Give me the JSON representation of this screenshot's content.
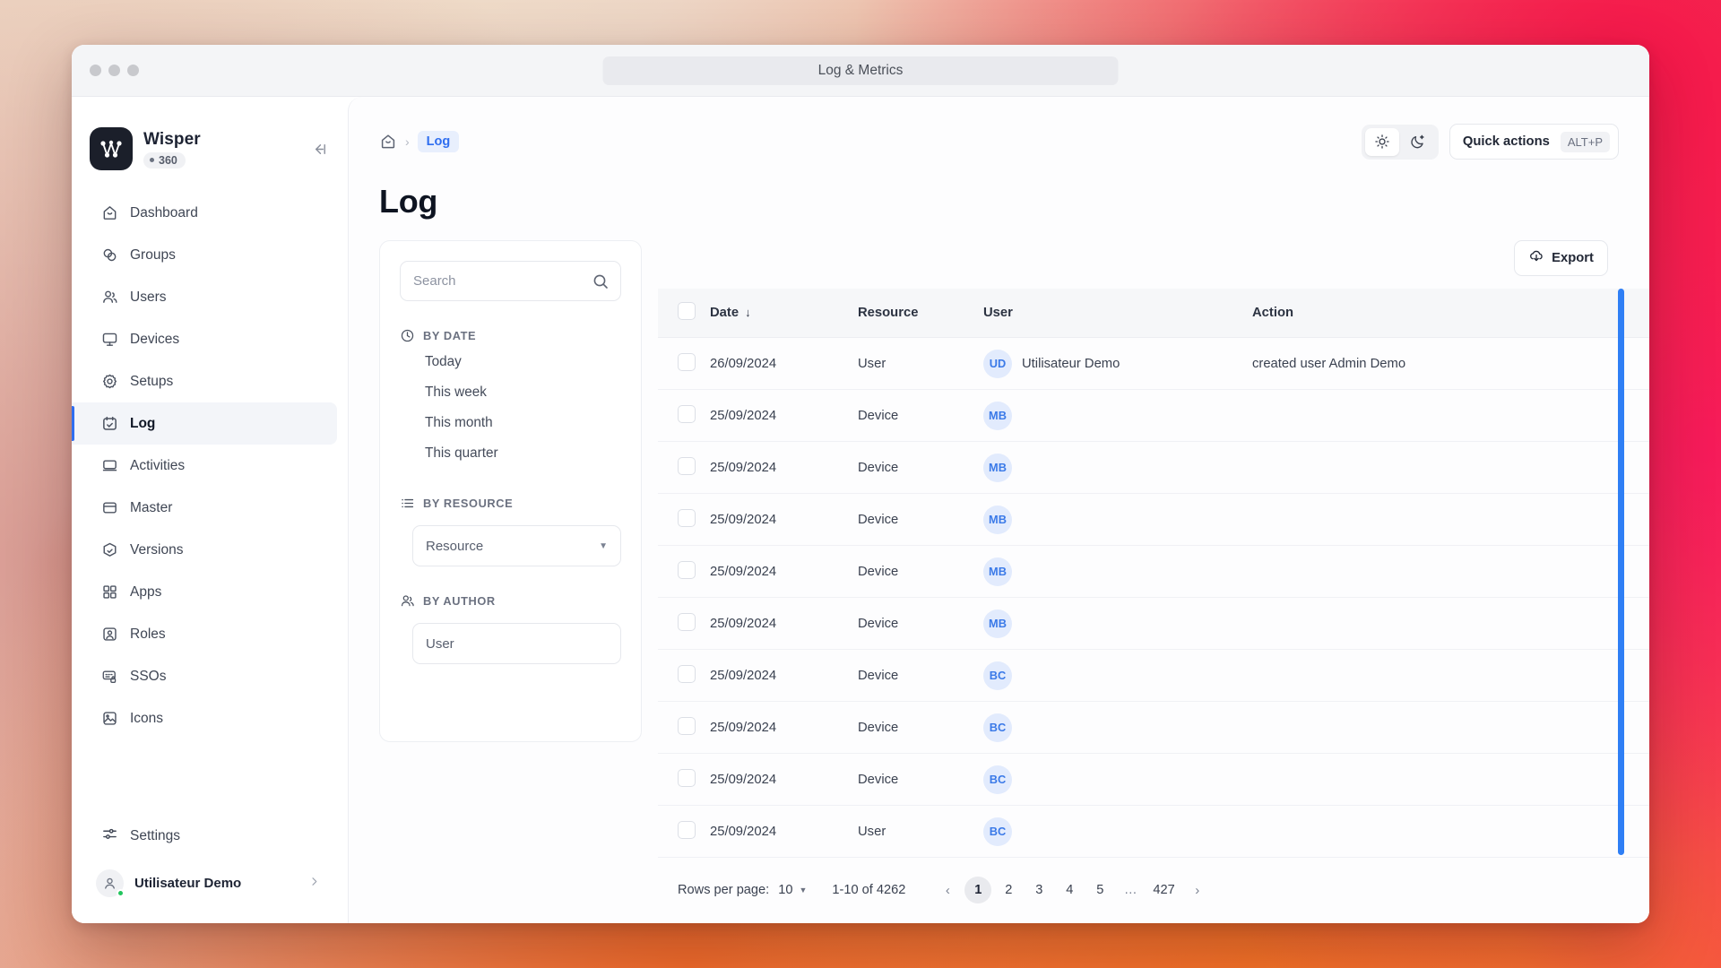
{
  "window": {
    "title": "Log & Metrics",
    "traffic_lights": [
      "close",
      "minimize",
      "maximize"
    ]
  },
  "sidebar": {
    "brand": {
      "name": "Wisper",
      "badge": "360",
      "logo_icon": "wisper-logo-icon"
    },
    "collapse_icon": "collapse-sidebar-icon",
    "items": [
      {
        "label": "Dashboard",
        "icon": "home-icon",
        "active": false
      },
      {
        "label": "Groups",
        "icon": "groups-icon",
        "active": false
      },
      {
        "label": "Users",
        "icon": "users-icon",
        "active": false
      },
      {
        "label": "Devices",
        "icon": "monitor-icon",
        "active": false
      },
      {
        "label": "Setups",
        "icon": "gear-icon",
        "active": false
      },
      {
        "label": "Log",
        "icon": "calendar-check-icon",
        "active": true
      },
      {
        "label": "Activities",
        "icon": "laptop-icon",
        "active": false
      },
      {
        "label": "Master",
        "icon": "window-icon",
        "active": false
      },
      {
        "label": "Versions",
        "icon": "box-check-icon",
        "active": false
      },
      {
        "label": "Apps",
        "icon": "grid-icon",
        "active": false
      },
      {
        "label": "Roles",
        "icon": "user-square-icon",
        "active": false
      },
      {
        "label": "SSOs",
        "icon": "sso-lock-icon",
        "active": false
      },
      {
        "label": "Icons",
        "icon": "image-icon",
        "active": false
      }
    ],
    "settings": {
      "label": "Settings",
      "icon": "sliders-icon"
    },
    "profile": {
      "name": "Utilisateur Demo",
      "avatar_icon": "user-avatar-icon",
      "status": "online",
      "chevron_icon": "chevron-right-icon"
    }
  },
  "topbar": {
    "breadcrumb": {
      "home_icon": "home-icon",
      "separator": "›",
      "current": "Log"
    },
    "theme": {
      "light_icon": "sun-icon",
      "dark_icon": "moon-icon",
      "selected": "light"
    },
    "quick_actions": {
      "label": "Quick actions",
      "shortcut": "ALT+P"
    }
  },
  "page": {
    "title": "Log"
  },
  "filters": {
    "search": {
      "placeholder": "Search",
      "value": "",
      "icon": "search-icon"
    },
    "by_date": {
      "label": "BY DATE",
      "icon": "clock-icon",
      "options": [
        "Today",
        "This week",
        "This month",
        "This quarter"
      ]
    },
    "by_resource": {
      "label": "BY RESOURCE",
      "icon": "list-icon",
      "select_placeholder": "Resource",
      "caret_icon": "chevron-down-icon"
    },
    "by_author": {
      "label": "BY AUTHOR",
      "icon": "users-icon",
      "input_placeholder": "User",
      "value": ""
    }
  },
  "toolbar": {
    "export_label": "Export",
    "export_icon": "cloud-download-icon"
  },
  "table": {
    "columns": [
      "Date",
      "Resource",
      "User",
      "Action"
    ],
    "sort": {
      "column": "Date",
      "direction": "desc",
      "icon": "arrow-down-icon"
    },
    "select_all_checkbox": false,
    "rows": [
      {
        "date": "26/09/2024",
        "resource": "User",
        "initials": "UD",
        "user": "Utilisateur Demo",
        "action": "created user Admin Demo"
      },
      {
        "date": "25/09/2024",
        "resource": "Device",
        "initials": "MB",
        "user": "",
        "action": ""
      },
      {
        "date": "25/09/2024",
        "resource": "Device",
        "initials": "MB",
        "user": "",
        "action": ""
      },
      {
        "date": "25/09/2024",
        "resource": "Device",
        "initials": "MB",
        "user": "",
        "action": ""
      },
      {
        "date": "25/09/2024",
        "resource": "Device",
        "initials": "MB",
        "user": "",
        "action": ""
      },
      {
        "date": "25/09/2024",
        "resource": "Device",
        "initials": "MB",
        "user": "",
        "action": ""
      },
      {
        "date": "25/09/2024",
        "resource": "Device",
        "initials": "BC",
        "user": "",
        "action": ""
      },
      {
        "date": "25/09/2024",
        "resource": "Device",
        "initials": "BC",
        "user": "",
        "action": ""
      },
      {
        "date": "25/09/2024",
        "resource": "Device",
        "initials": "BC",
        "user": "",
        "action": ""
      },
      {
        "date": "25/09/2024",
        "resource": "User",
        "initials": "BC",
        "user": "",
        "action": ""
      }
    ]
  },
  "pagination": {
    "rows_per_page_label": "Rows per page:",
    "rows_per_page_value": "10",
    "range_label": "1-10 of 4262",
    "prev_icon": "‹",
    "next_icon": "›",
    "pages": [
      "1",
      "2",
      "3",
      "4",
      "5",
      "…",
      "427"
    ],
    "current_page": "1"
  },
  "colors": {
    "accent": "#2f6ef0",
    "scrollbar": "#2f7ff5",
    "avatar_bg": "#e2ebfd",
    "avatar_text": "#3b7ae8",
    "online": "#22c55e"
  }
}
